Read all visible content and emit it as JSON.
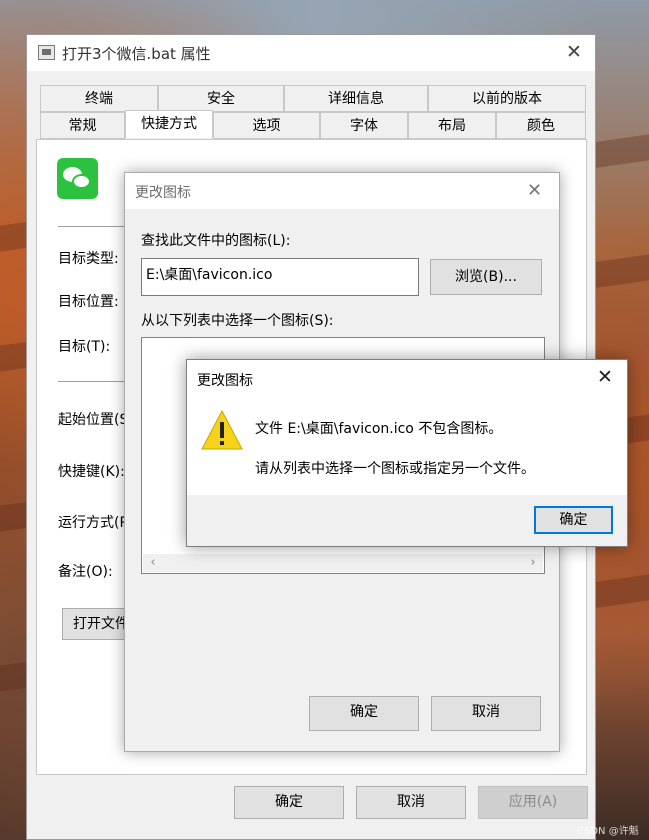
{
  "properties": {
    "title": "打开3个微信.bat 属性",
    "close_glyph": "✕",
    "tabs_top": [
      "终端",
      "安全",
      "详细信息",
      "以前的版本"
    ],
    "tabs_bottom": [
      "常规",
      "快捷方式",
      "选项",
      "字体",
      "布局",
      "颜色"
    ],
    "active_tab": "快捷方式",
    "fields": {
      "target_type": "目标类型:",
      "target_location": "目标位置:",
      "target": "目标(T):",
      "start_in": "起始位置(S):",
      "shortcut_key": "快捷键(K):",
      "run": "运行方式(R):",
      "comment": "备注(O):"
    },
    "open_location_button": "打开文件所在的位置(F)",
    "buttons": {
      "ok": "确定",
      "cancel": "取消",
      "apply": "应用(A)"
    }
  },
  "change_icon": {
    "title": "更改图标",
    "close_glyph": "✕",
    "look_label": "查找此文件中的图标(L):",
    "path_value": "E:\\桌面\\favicon.ico",
    "browse_button": "浏览(B)...",
    "list_label": "从以下列表中选择一个图标(S):",
    "scroll_left": "‹",
    "scroll_right": "›",
    "buttons": {
      "ok": "确定",
      "cancel": "取消"
    }
  },
  "error_dialog": {
    "title": "更改图标",
    "close_glyph": "✕",
    "message_line1": "文件 E:\\桌面\\favicon.ico 不包含图标。",
    "message_line2": "请从列表中选择一个图标或指定另一个文件。",
    "ok_button": "确定",
    "icon": "warning-icon",
    "warning_color": "#f6d21a"
  },
  "watermark": "CSDN @许魁"
}
